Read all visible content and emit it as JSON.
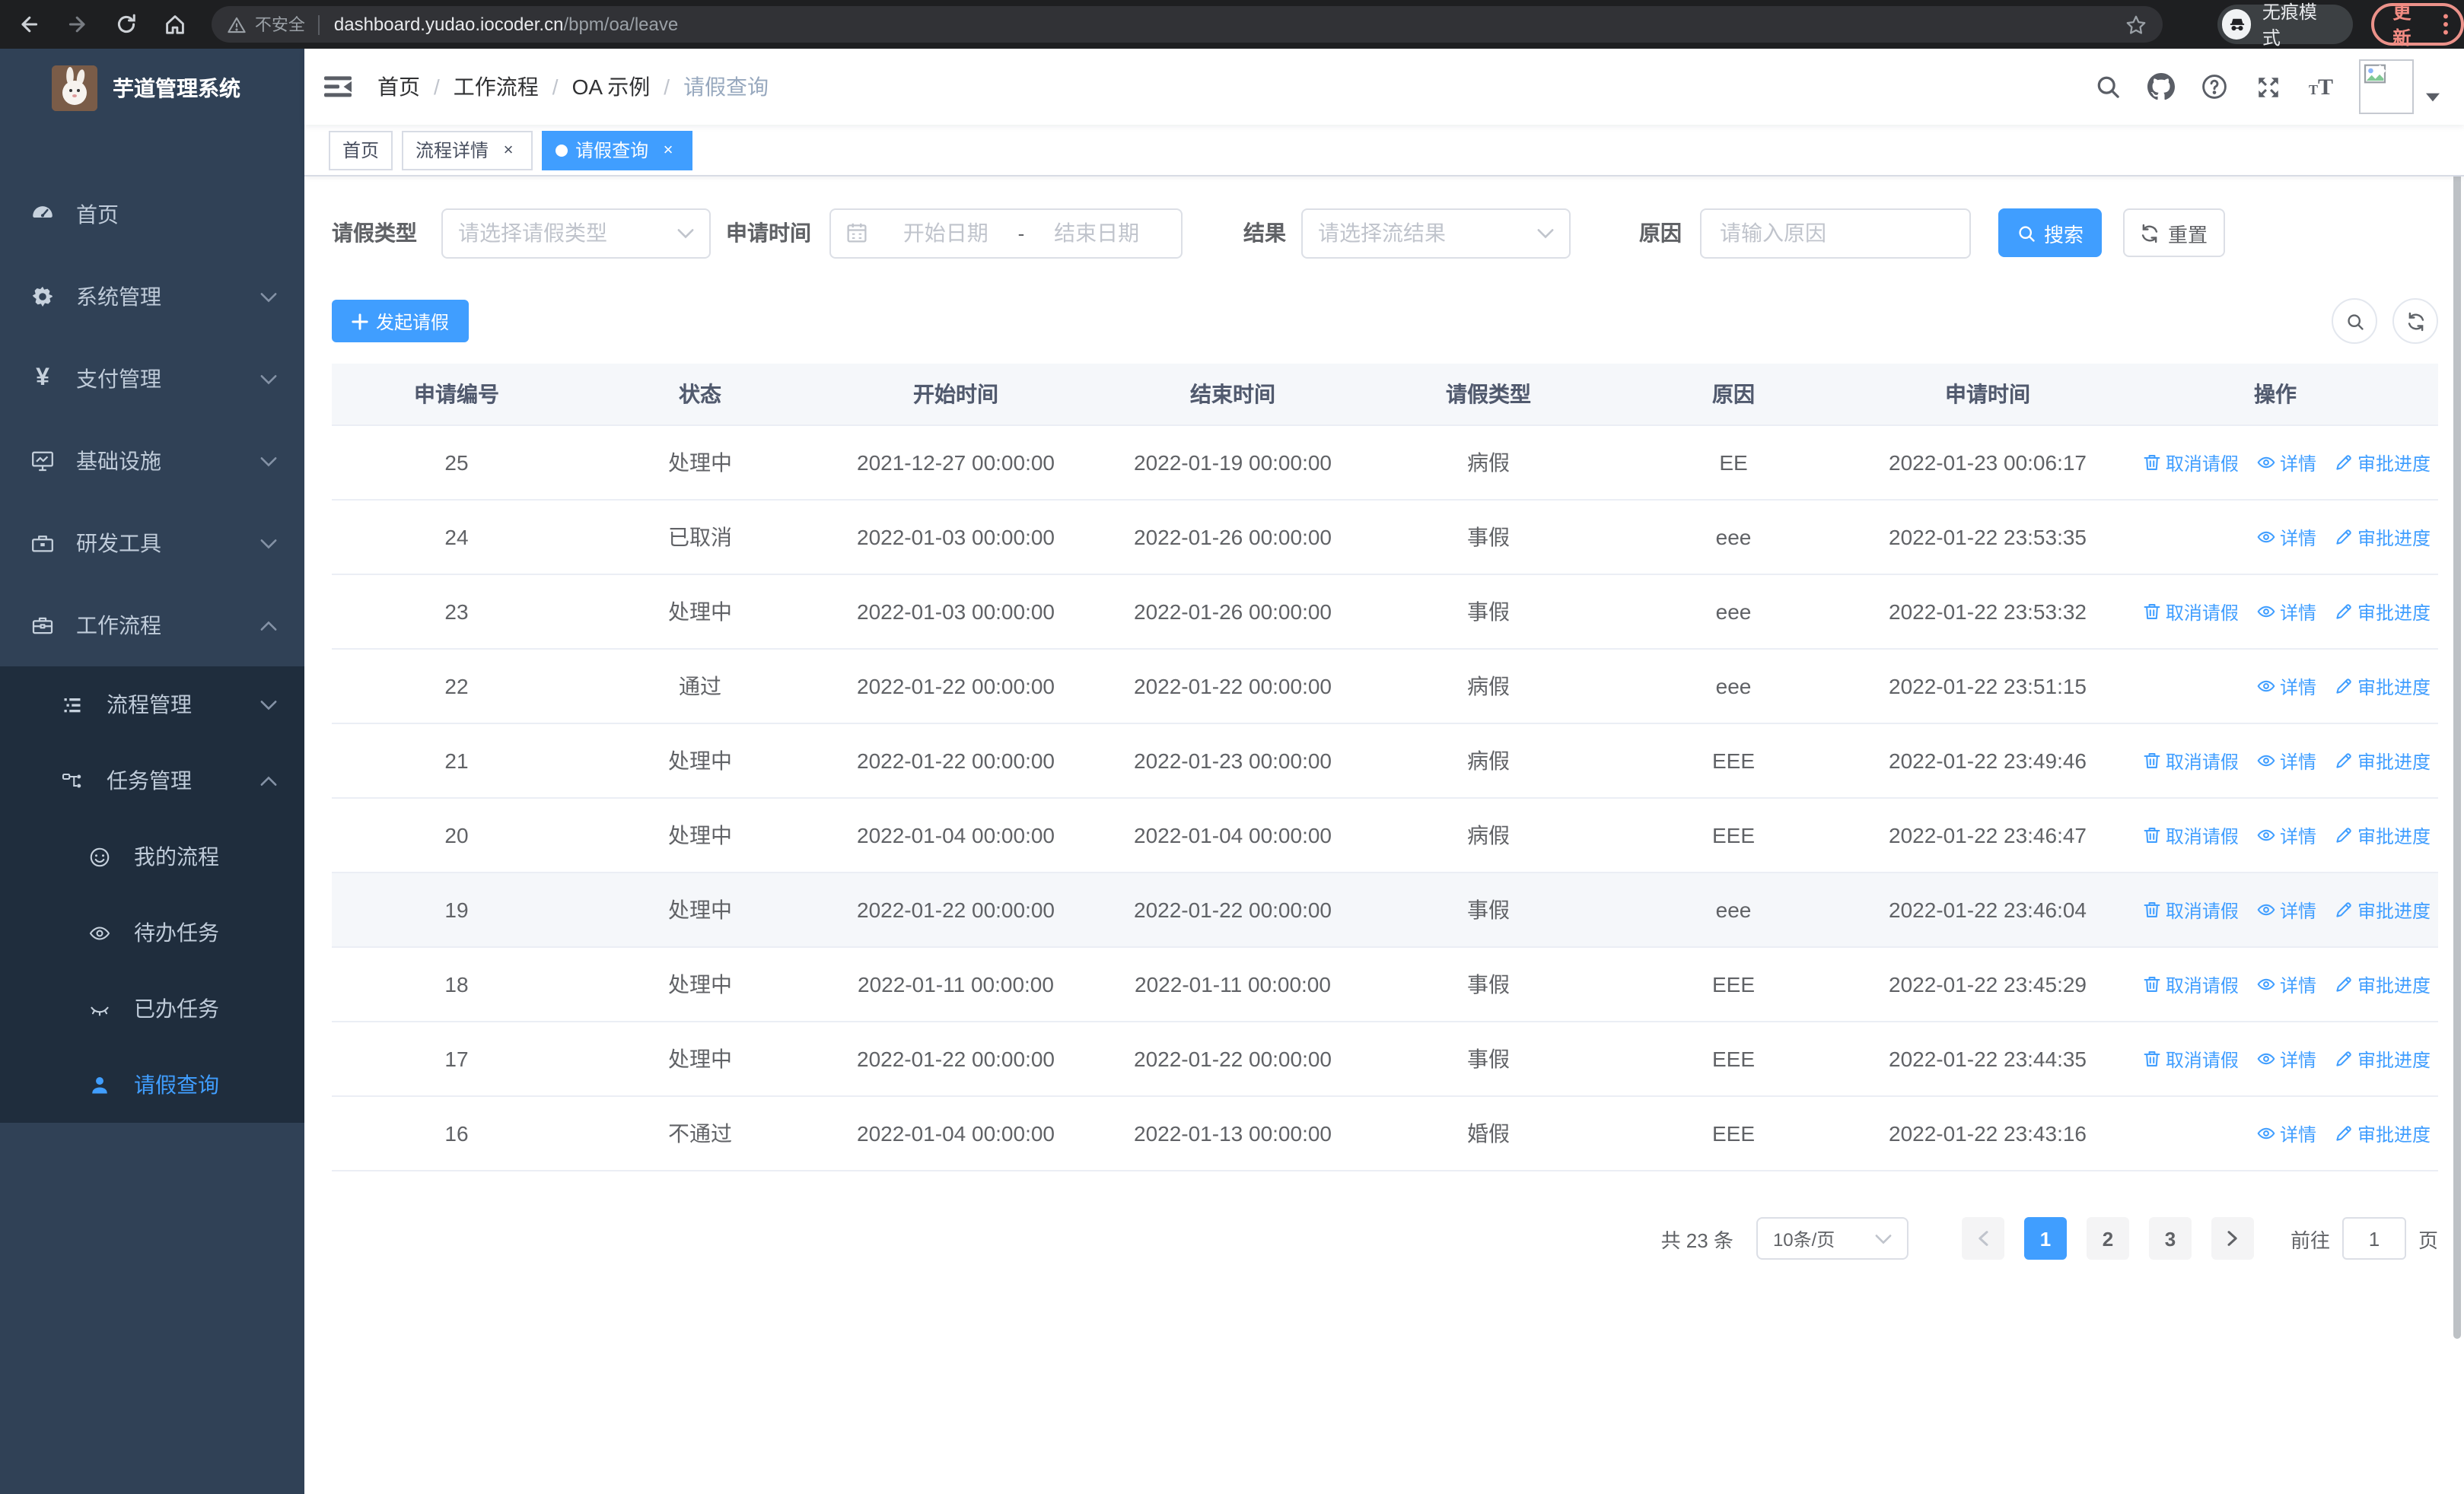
{
  "colors": {
    "accent": "#409eff",
    "sidebar_bg": "#304156",
    "submenu_bg": "#1f2d3d",
    "active_tag_bg": "#409eff",
    "chrome_bg": "#1e1f21",
    "update_accent": "#f28b82"
  },
  "browser": {
    "security_label": "不安全",
    "url_host": "dashboard.yudao.iocoder.cn",
    "url_path": "/bpm/oa/leave",
    "incognito_label": "无痕模式",
    "update_label": "更新",
    "icons": [
      "back-icon",
      "forward-icon",
      "reload-icon",
      "home-icon",
      "warning-icon",
      "star-icon",
      "incognito-icon",
      "kebab-menu-icon"
    ]
  },
  "sidebar": {
    "logo_title": "芋道管理系统",
    "menu": [
      {
        "label": "首页",
        "icon": "dashboard-icon",
        "level": 1,
        "arrow": null,
        "active": false,
        "group": "root"
      },
      {
        "label": "系统管理",
        "icon": "gear-icon",
        "level": 1,
        "arrow": "down",
        "active": false,
        "group": "root"
      },
      {
        "label": "支付管理",
        "icon": "yen-icon",
        "level": 1,
        "arrow": "down",
        "active": false,
        "group": "root"
      },
      {
        "label": "基础设施",
        "icon": "monitor-icon",
        "level": 1,
        "arrow": "down",
        "active": false,
        "group": "root"
      },
      {
        "label": "研发工具",
        "icon": "toolbox-icon",
        "level": 1,
        "arrow": "down",
        "active": false,
        "group": "root"
      },
      {
        "label": "工作流程",
        "icon": "briefcase-icon",
        "level": 1,
        "arrow": "up",
        "active": false,
        "group": "root"
      },
      {
        "label": "流程管理",
        "icon": "list-icon",
        "level": 2,
        "arrow": "down",
        "active": false,
        "group": "sub"
      },
      {
        "label": "任务管理",
        "icon": "flow-icon",
        "level": 2,
        "arrow": "up",
        "active": false,
        "group": "sub"
      },
      {
        "label": "我的流程",
        "icon": "face-icon",
        "level": 3,
        "arrow": null,
        "active": false,
        "group": "sub"
      },
      {
        "label": "待办任务",
        "icon": "eye-open-icon",
        "level": 3,
        "arrow": null,
        "active": false,
        "group": "sub"
      },
      {
        "label": "已办任务",
        "icon": "eye-closed-icon",
        "level": 3,
        "arrow": null,
        "active": false,
        "group": "sub"
      },
      {
        "label": "请假查询",
        "icon": "user-icon",
        "level": 3,
        "arrow": null,
        "active": true,
        "group": "sub"
      }
    ]
  },
  "navbar": {
    "breadcrumb": [
      "首页",
      "工作流程",
      "OA 示例",
      "请假查询"
    ],
    "right_icons": [
      "search-icon",
      "github-icon",
      "help-icon",
      "fullscreen-icon",
      "font-size-icon",
      "avatar-broken-image-icon",
      "caret-down-icon"
    ]
  },
  "tags": [
    {
      "label": "首页",
      "closable": false,
      "active": false
    },
    {
      "label": "流程详情",
      "closable": true,
      "active": false
    },
    {
      "label": "请假查询",
      "closable": true,
      "active": true
    }
  ],
  "filters": {
    "leave_type": {
      "label": "请假类型",
      "placeholder": "请选择请假类型"
    },
    "apply_time": {
      "label": "申请时间",
      "start_placeholder": "开始日期",
      "separator": "-",
      "end_placeholder": "结束日期"
    },
    "result": {
      "label": "结果",
      "placeholder": "请选择流结果"
    },
    "reason": {
      "label": "原因",
      "placeholder": "请输入原因"
    },
    "search_label": "搜索",
    "reset_label": "重置"
  },
  "toolbar": {
    "create_label": "发起请假"
  },
  "table": {
    "columns": [
      "申请编号",
      "状态",
      "开始时间",
      "结束时间",
      "请假类型",
      "原因",
      "申请时间",
      "操作"
    ],
    "action_labels": {
      "cancel": "取消请假",
      "detail": "详情",
      "progress": "审批进度"
    },
    "action_icons": {
      "cancel": "trash-icon",
      "detail": "eye-icon",
      "progress": "edit-icon"
    },
    "rows": [
      {
        "id": "25",
        "status": "处理中",
        "start": "2021-12-27 00:00:00",
        "end": "2022-01-19 00:00:00",
        "type": "病假",
        "reason": "EE",
        "apply_time": "2022-01-23 00:06:17",
        "actions": [
          "cancel",
          "detail",
          "progress"
        ],
        "highlighted": false
      },
      {
        "id": "24",
        "status": "已取消",
        "start": "2022-01-03 00:00:00",
        "end": "2022-01-26 00:00:00",
        "type": "事假",
        "reason": "eee",
        "apply_time": "2022-01-22 23:53:35",
        "actions": [
          "detail",
          "progress"
        ],
        "highlighted": false
      },
      {
        "id": "23",
        "status": "处理中",
        "start": "2022-01-03 00:00:00",
        "end": "2022-01-26 00:00:00",
        "type": "事假",
        "reason": "eee",
        "apply_time": "2022-01-22 23:53:32",
        "actions": [
          "cancel",
          "detail",
          "progress"
        ],
        "highlighted": false
      },
      {
        "id": "22",
        "status": "通过",
        "start": "2022-01-22 00:00:00",
        "end": "2022-01-22 00:00:00",
        "type": "病假",
        "reason": "eee",
        "apply_time": "2022-01-22 23:51:15",
        "actions": [
          "detail",
          "progress"
        ],
        "highlighted": false
      },
      {
        "id": "21",
        "status": "处理中",
        "start": "2022-01-22 00:00:00",
        "end": "2022-01-23 00:00:00",
        "type": "病假",
        "reason": "EEE",
        "apply_time": "2022-01-22 23:49:46",
        "actions": [
          "cancel",
          "detail",
          "progress"
        ],
        "highlighted": false
      },
      {
        "id": "20",
        "status": "处理中",
        "start": "2022-01-04 00:00:00",
        "end": "2022-01-04 00:00:00",
        "type": "病假",
        "reason": "EEE",
        "apply_time": "2022-01-22 23:46:47",
        "actions": [
          "cancel",
          "detail",
          "progress"
        ],
        "highlighted": false
      },
      {
        "id": "19",
        "status": "处理中",
        "start": "2022-01-22 00:00:00",
        "end": "2022-01-22 00:00:00",
        "type": "事假",
        "reason": "eee",
        "apply_time": "2022-01-22 23:46:04",
        "actions": [
          "cancel",
          "detail",
          "progress"
        ],
        "highlighted": true
      },
      {
        "id": "18",
        "status": "处理中",
        "start": "2022-01-11 00:00:00",
        "end": "2022-01-11 00:00:00",
        "type": "事假",
        "reason": "EEE",
        "apply_time": "2022-01-22 23:45:29",
        "actions": [
          "cancel",
          "detail",
          "progress"
        ],
        "highlighted": false
      },
      {
        "id": "17",
        "status": "处理中",
        "start": "2022-01-22 00:00:00",
        "end": "2022-01-22 00:00:00",
        "type": "事假",
        "reason": "EEE",
        "apply_time": "2022-01-22 23:44:35",
        "actions": [
          "cancel",
          "detail",
          "progress"
        ],
        "highlighted": false
      },
      {
        "id": "16",
        "status": "不通过",
        "start": "2022-01-04 00:00:00",
        "end": "2022-01-13 00:00:00",
        "type": "婚假",
        "reason": "EEE",
        "apply_time": "2022-01-22 23:43:16",
        "actions": [
          "detail",
          "progress"
        ],
        "highlighted": false
      }
    ]
  },
  "pagination": {
    "total_label": "共 23 条",
    "page_size": "10条/页",
    "pages": [
      "1",
      "2",
      "3"
    ],
    "current": "1",
    "goto_label": "前往",
    "goto_value": "1",
    "goto_suffix": "页"
  }
}
